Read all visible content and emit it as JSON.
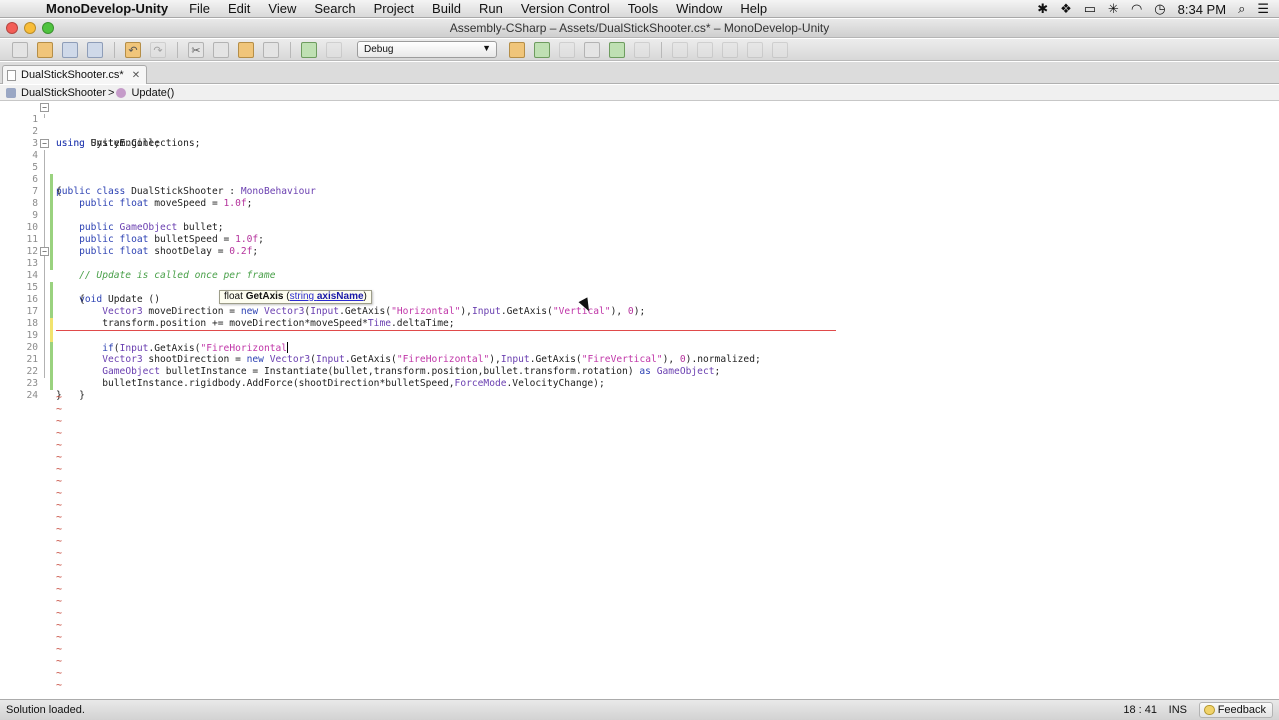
{
  "menubar": {
    "app_name": "MonoDevelop-Unity",
    "items": [
      "File",
      "Edit",
      "View",
      "Search",
      "Project",
      "Build",
      "Run",
      "Version Control",
      "Tools",
      "Window",
      "Help"
    ],
    "clock": "8:34 PM"
  },
  "window": {
    "title": "Assembly-CSharp – Assets/DualStickShooter.cs* – MonoDevelop-Unity"
  },
  "toolbar": {
    "configuration": "Debug"
  },
  "tabs": [
    {
      "label": "DualStickShooter.cs*",
      "close": "✕"
    }
  ],
  "breadcrumb": {
    "class_name": "DualStickShooter",
    "separator": ">",
    "method_name": "Update()"
  },
  "tooltip": {
    "return_type": "float",
    "method": "GetAxis",
    "open_paren": "(",
    "param_type": "string",
    "param_name": "axisName",
    "close_paren": ")"
  },
  "code_lines": [
    "using UnityEngine;",
    "using System.Collections;",
    "",
    "public class DualStickShooter : MonoBehaviour",
    "{",
    "    public float moveSpeed = 1.0f;",
    "",
    "    public GameObject bullet;",
    "    public float bulletSpeed = 1.0f;",
    "    public float shootDelay = 0.2f;",
    "",
    "    // Update is called once per frame",
    "    void Update ()",
    "    {",
    "        Vector3 moveDirection = new Vector3(Input.GetAxis(\"Horizontal\"),Input.GetAxis(\"Vertical\"), 0);",
    "        transform.position += moveDirection*moveSpeed*Time.deltaTime;",
    "",
    "        if(Input.GetAxis(\"FireHorizontal",
    "        Vector3 shootDirection = new Vector3(Input.GetAxis(\"FireHorizontal\"),Input.GetAxis(\"FireVertical\"), 0).normalized;",
    "        GameObject bulletInstance = Instantiate(bullet,transform.position,bullet.transform.rotation) as GameObject;",
    "        bulletInstance.rigidbody.AddForce(shootDirection*bulletSpeed,ForceMode.VelocityChange);",
    "    }",
    "}",
    ""
  ],
  "line_numbers": [
    "1",
    "2",
    "3",
    "4",
    "5",
    "6",
    "7",
    "8",
    "9",
    "10",
    "11",
    "12",
    "13",
    "14",
    "15",
    "16",
    "17",
    "18",
    "19",
    "20",
    "21",
    "22",
    "23",
    "24"
  ],
  "empty_line_marker": "~",
  "statusbar": {
    "message": "Solution loaded.",
    "position": "18 : 41",
    "mode": "INS",
    "feedback_label": "Feedback"
  },
  "colors": {
    "keyword": "#2d42b3",
    "type": "#6a3fb0",
    "string": "#c036a8",
    "comment": "#49a049",
    "error": "#e04a4a"
  }
}
